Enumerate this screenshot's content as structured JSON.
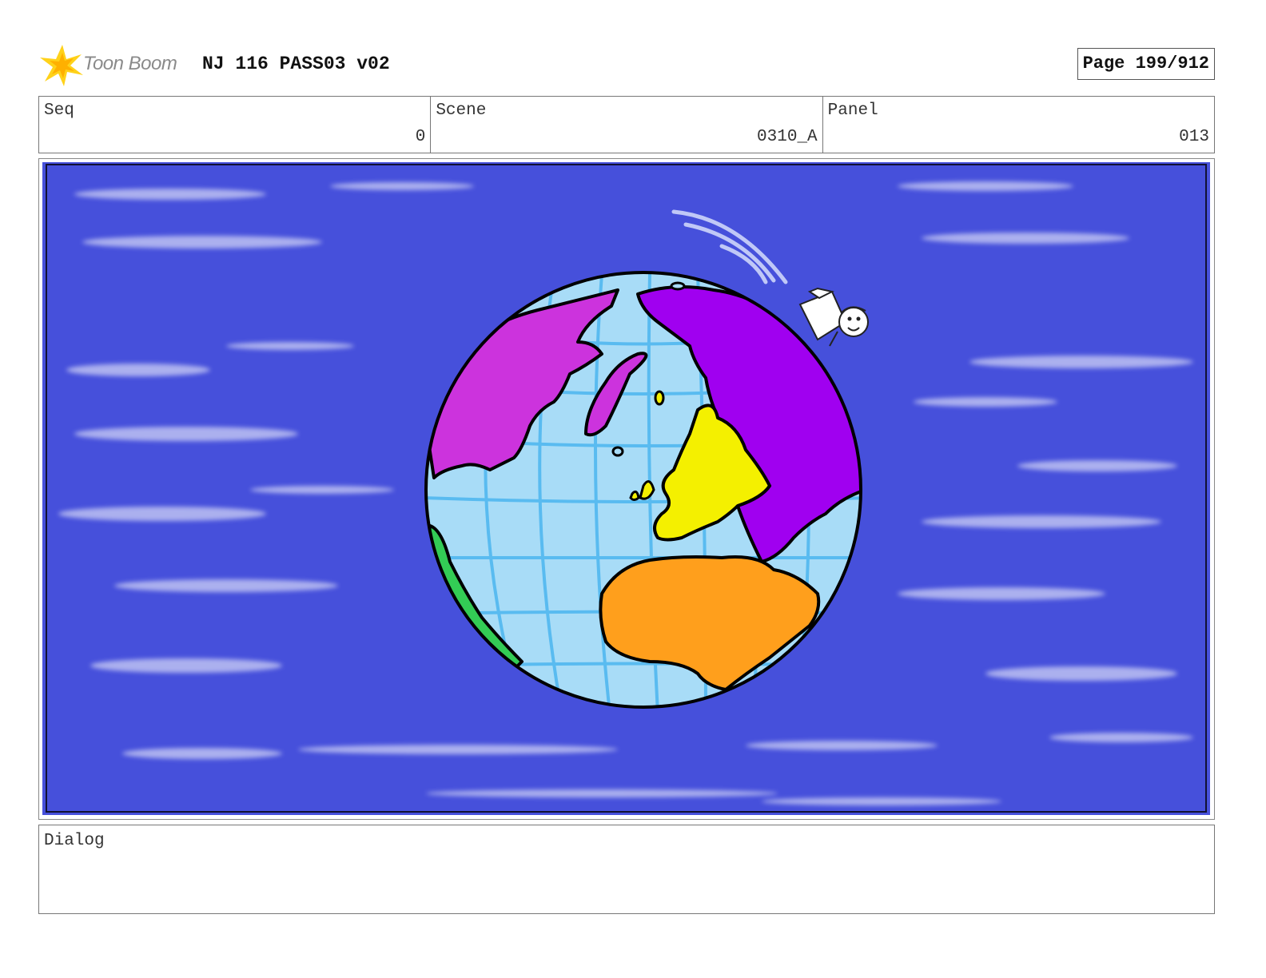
{
  "header": {
    "logo_text": "Toon Boom",
    "title": "NJ 116 PASS03 v02",
    "page": "Page 199/912"
  },
  "info": {
    "seq_label": "Seq",
    "seq_value": "0",
    "scene_label": "Scene",
    "scene_value": "0310_A",
    "panel_label": "Panel",
    "panel_value": "013"
  },
  "dialog": {
    "label": "Dialog",
    "text": ""
  },
  "colors": {
    "space": "#4650db",
    "ocean": "#a8dcf7",
    "grid": "#3fb0ee",
    "north_america": "#cc33dd",
    "eurasia_east": "#a000f0",
    "europe": "#f4f000",
    "africa": "#ff9f1c",
    "south_america": "#33cc55",
    "logo_star": "#ffd21a"
  },
  "icons": {
    "logo": "toon-boom-star-logo"
  }
}
